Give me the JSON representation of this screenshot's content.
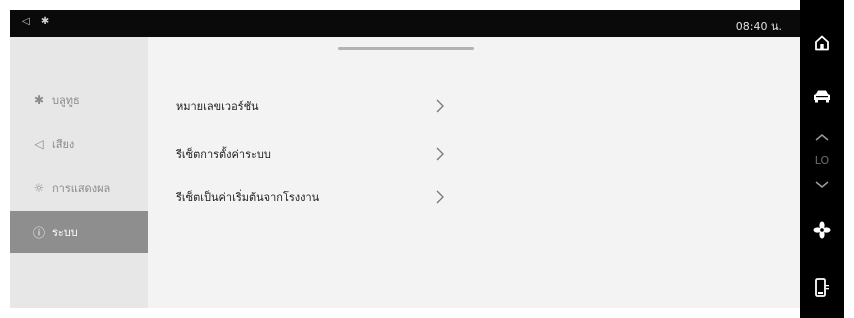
{
  "status_bar": {
    "clock": "08:40 น.",
    "icons": "◁ ✱"
  },
  "sidebar": {
    "items": [
      {
        "label": "บลูทูธ",
        "icon": "✱",
        "icon_name": "bluetooth-icon"
      },
      {
        "label": "เสียง",
        "icon": "◁",
        "icon_name": "speaker-icon"
      },
      {
        "label": "การแสดงผล",
        "icon": "☼",
        "icon_name": "brightness-icon"
      },
      {
        "label": "ระบบ",
        "icon": "ⓘ",
        "icon_name": "info-icon",
        "active": true
      }
    ]
  },
  "main": {
    "rows": [
      {
        "label": "หมายเลขเวอร์ชัน"
      },
      {
        "label": "รีเซ็ตการตั้งค่าระบบ"
      },
      {
        "label": "รีเซ็ตเป็นค่าเริ่มต้นจากโรงงาน"
      }
    ]
  },
  "right_bar": {
    "temperature": "LO",
    "icons": [
      "home-icon",
      "car-icon",
      "chevron-up-icon",
      "chevron-down-icon",
      "fan-icon",
      "phone-icon"
    ]
  },
  "colors": {
    "active_item": "#8e8e8e",
    "sidebar_bg": "#e7e7e7",
    "main_bg": "#f3f3f3",
    "bar": "#000000"
  }
}
